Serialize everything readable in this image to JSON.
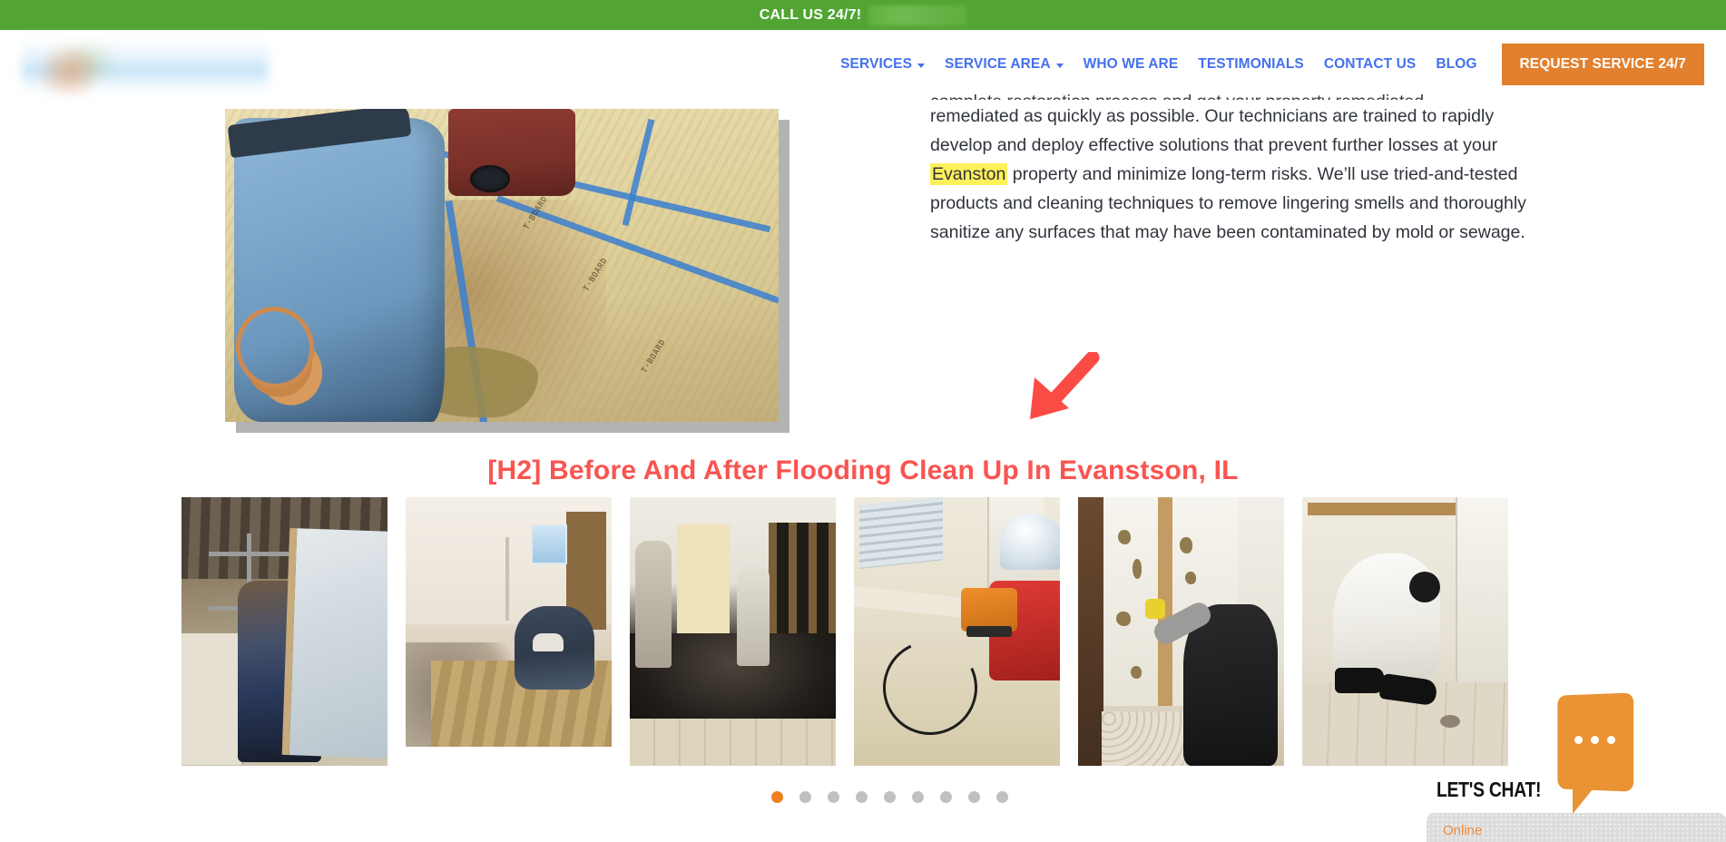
{
  "callbar": {
    "text": "CALL US 24/7!",
    "phone_redacted": "",
    "bg_color": "#52a533"
  },
  "header": {
    "logo_alt": "",
    "nav": [
      {
        "label": "SERVICES",
        "has_caret": true
      },
      {
        "label": "SERVICE AREA",
        "has_caret": true
      },
      {
        "label": "WHO WE ARE",
        "has_caret": false
      },
      {
        "label": "TESTIMONIALS",
        "has_caret": false
      },
      {
        "label": "CONTACT US",
        "has_caret": false
      },
      {
        "label": "BLOG",
        "has_caret": false
      }
    ],
    "cta_label": "REQUEST SERVICE 24/7",
    "nav_color": "#4470ef",
    "cta_color": "#e2802e"
  },
  "main": {
    "paragraph_clipped_top": "complete restoration process and get your property remediated",
    "paragraph": {
      "part1": "remediated as quickly as possible. Our technicians are trained to rapidly develop and deploy effective solutions that prevent further losses at your ",
      "highlight": "Evanston",
      "part2": " property and minimize long-term risks. We’ll use tried-and-tested products and cleaning techniques to remove lingering smells and thoroughly sanitize any surfaces that may have been contaminated by mold or sewage.",
      "highlight_color": "#fdf05a"
    },
    "hero_image_alt": "Technician in blue jeans standing on protective floor board next to red air mover in flood-damaged room",
    "annotation_arrow": "red-arrow-pointing-down-left",
    "heading": "[H2] Before And After Flooding Clean Up In Evanstson, IL",
    "heading_color": "#fa5450"
  },
  "carousel": {
    "slides": [
      {
        "alt": "Worker removing ceiling panels during demolition"
      },
      {
        "alt": "Worker removing carpet and padding from floor"
      },
      {
        "alt": "Dark flooded hallway with technicians in protective suits"
      },
      {
        "alt": "Orange air mover and red dehumidifier drying a room"
      },
      {
        "alt": "Worker in black removing damaged drywall from a wall"
      },
      {
        "alt": "Technician in white protective suit inspecting a wall"
      }
    ],
    "dots": [
      {
        "active": true
      },
      {
        "active": false
      },
      {
        "active": false
      },
      {
        "active": false
      },
      {
        "active": false
      },
      {
        "active": false
      },
      {
        "active": false
      },
      {
        "active": false
      },
      {
        "active": false
      }
    ],
    "dot_active_color": "#ef7f1f",
    "dot_inactive_color": "#c0c0c0"
  },
  "chat_widget": {
    "label": "LET'S CHAT!",
    "status": "Online",
    "bubble_color": "#e99334",
    "status_color": "#ef8b3c"
  }
}
